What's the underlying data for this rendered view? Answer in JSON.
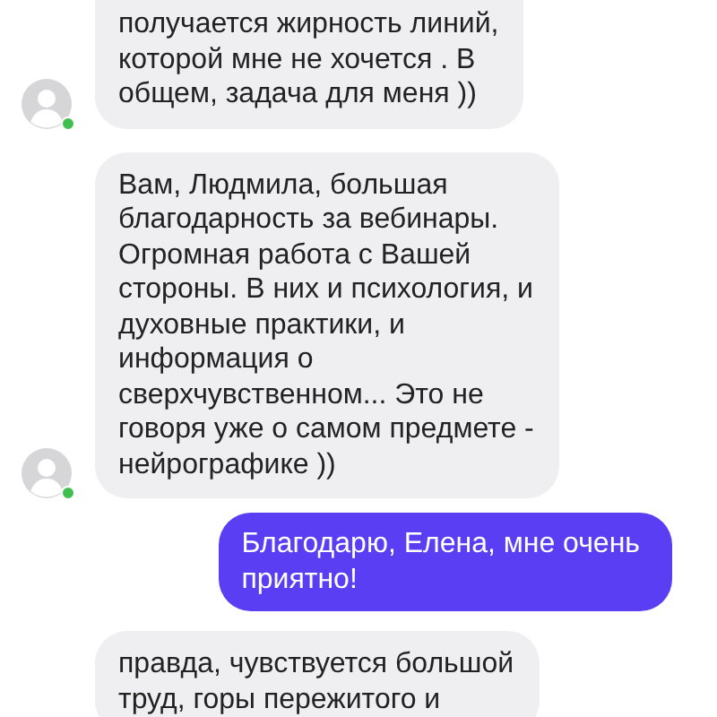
{
  "messages": [
    {
      "kind": "incoming",
      "lines": [
        "получается жирность линий,",
        "которой мне не хочется . В",
        "общем, задача для меня ))"
      ],
      "avatar": {
        "online": true
      }
    },
    {
      "kind": "incoming",
      "lines": [
        "Вам, Людмила, большая",
        "благодарность за вебинары.",
        "Огромная работа с Вашей",
        "стороны. В них и психология, и",
        "духовные практики, и",
        "информация о",
        "сверхчувственном... Это не",
        "говоря уже о самом предмете -",
        "нейрографике ))"
      ],
      "avatar": {
        "online": true
      }
    },
    {
      "kind": "outgoing",
      "lines": [
        "Благодарю, Елена, мне очень",
        "приятно!"
      ]
    },
    {
      "kind": "incoming",
      "lines": [
        "правда, чувствуется большой",
        "труд, горы пережитого и"
      ]
    }
  ]
}
